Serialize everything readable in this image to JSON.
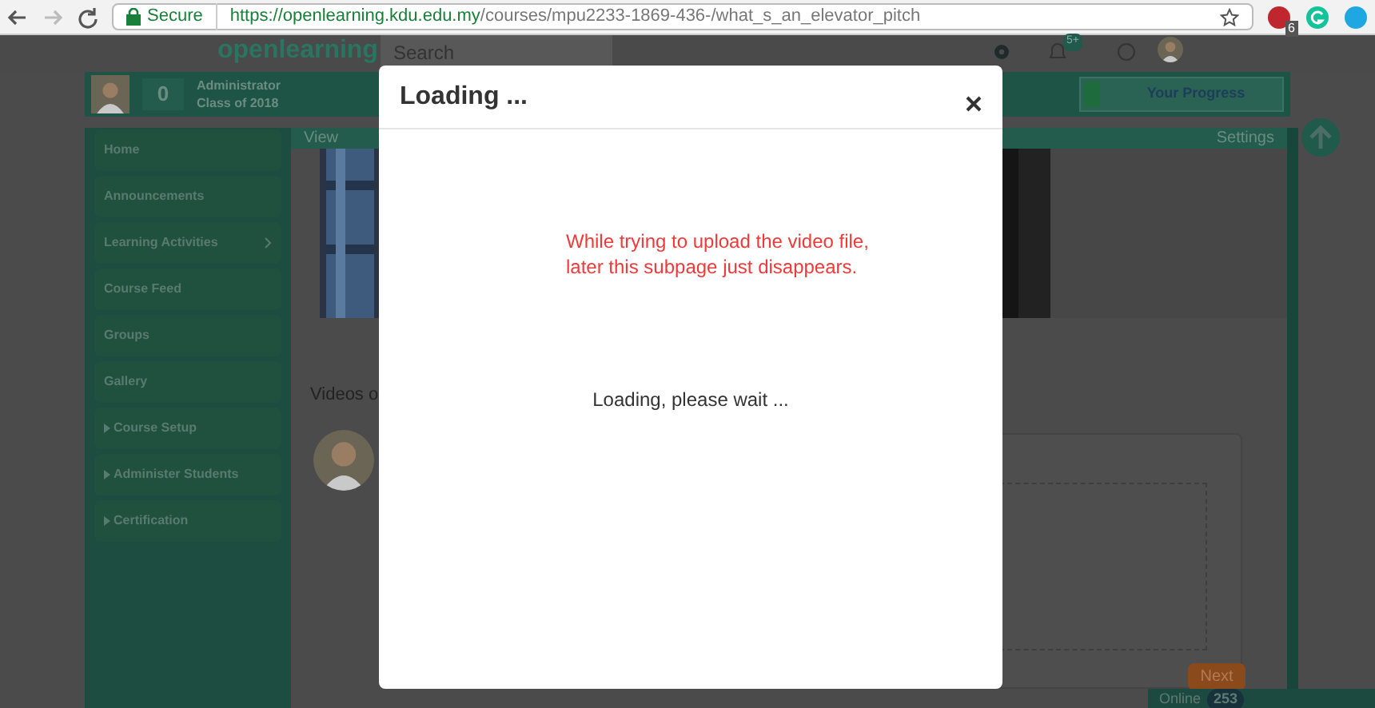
{
  "browser": {
    "secure_label": "Secure",
    "url_host": "https://openlearning.kdu.edu.my",
    "url_path": "/courses/mpu2233-1869-436-/what_s_an_elevator_pitch",
    "extension_badge": "6"
  },
  "header": {
    "logo": "openlearning",
    "search": {
      "placeholder": "Search"
    },
    "notification_badge": "5+"
  },
  "profile": {
    "points": "0",
    "role": "Administrator",
    "class": "Class of 2018",
    "progress_label": "Your Progress"
  },
  "sidebar": {
    "items": [
      {
        "label": "Home",
        "kind": "plain"
      },
      {
        "label": "Announcements",
        "kind": "plain"
      },
      {
        "label": "Learning Activities",
        "kind": "submenu"
      },
      {
        "label": "Course Feed",
        "kind": "plain"
      },
      {
        "label": "Groups",
        "kind": "plain"
      },
      {
        "label": "Gallery",
        "kind": "plain"
      },
      {
        "label": "Course Setup",
        "kind": "collapsible"
      },
      {
        "label": "Administer Students",
        "kind": "collapsible"
      },
      {
        "label": "Certification",
        "kind": "collapsible"
      }
    ]
  },
  "content": {
    "view_tab": "View",
    "settings_link": "Settings",
    "videos_heading": "Videos o",
    "next_button": "Next"
  },
  "online": {
    "label": "Online",
    "count": "253"
  },
  "modal": {
    "title": "Loading ...",
    "annotation": [
      "While trying to upload the video file,",
      "later this subpage just disappears."
    ],
    "message": "Loading, please wait ..."
  }
}
